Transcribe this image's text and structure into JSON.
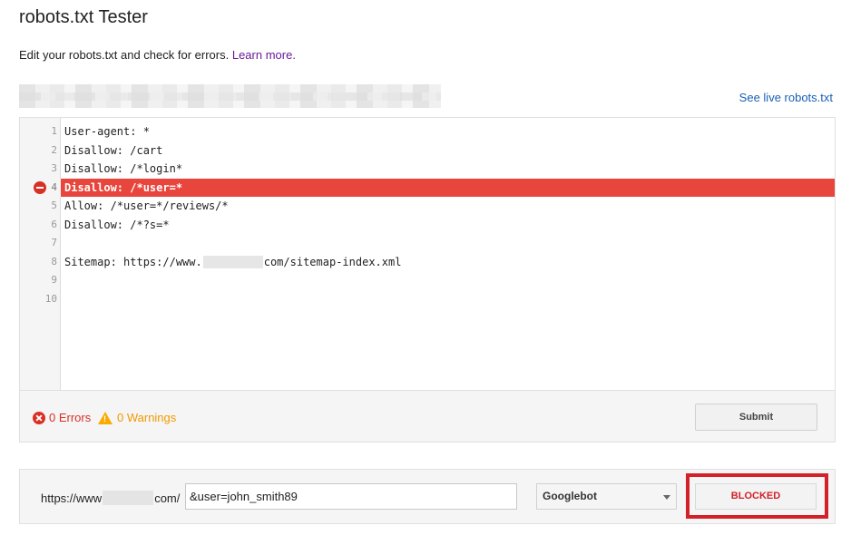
{
  "header": {
    "title": "robots.txt Tester",
    "subtitle": "Edit your robots.txt and check for errors.",
    "learn_more": "Learn more.",
    "see_live": "See live robots.txt"
  },
  "editor": {
    "lines": [
      {
        "num": "1",
        "text": "User-agent: *"
      },
      {
        "num": "2",
        "text": "Disallow: /cart"
      },
      {
        "num": "3",
        "text": "Disallow: /*login*"
      },
      {
        "num": "4",
        "text": "Disallow: /*user=*"
      },
      {
        "num": "5",
        "text": "Allow: /*user=*/reviews/*"
      },
      {
        "num": "6",
        "text": "Disallow: /*?s=*"
      },
      {
        "num": "7",
        "text": ""
      },
      {
        "num": "8",
        "text_before": "Sitemap: https://www.",
        "text_after": "com/sitemap-index.xml"
      },
      {
        "num": "9",
        "text": ""
      },
      {
        "num": "10",
        "text": ""
      }
    ],
    "error_line": "4"
  },
  "status": {
    "errors": "0 Errors",
    "warnings": "0 Warnings",
    "submit": "Submit"
  },
  "test": {
    "url_prefix": "https://www",
    "url_suffix": "com/",
    "path_value": "&user=john_smith89",
    "bot": "Googlebot",
    "result": "BLOCKED"
  },
  "colors": {
    "error_line_bg": "#e8453c",
    "blocked": "#d32029",
    "warning": "#f29900",
    "link": "#1a5fb4"
  }
}
